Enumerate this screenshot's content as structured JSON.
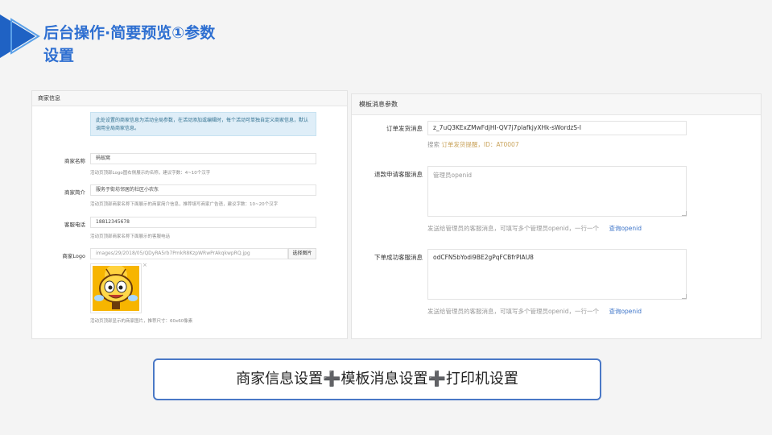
{
  "slide": {
    "title": "后台操作·简要预览①参数设置",
    "summary": "商家信息设置➕模板消息设置➕打印机设置"
  },
  "merchant_panel": {
    "heading": "商家信息",
    "notice": "此处设置的商家信息为活动全局参数，在活动添加或编辑时，每个活动可单独自定义商家信息，默认调用全局商家信息。",
    "name": {
      "label": "商家名称",
      "value": "蚂蚁窝",
      "help": "活动页顶部Logo图右侧展示的名称，建议字数：4~10个汉字"
    },
    "intro": {
      "label": "商家简介",
      "value": "服务于街坊邻居的社区小农东",
      "help": "活动页顶部商家名称下面展示的商家简介信息，推荐填写商家广告语，建议字数：10~20个汉字"
    },
    "phone": {
      "label": "客服电话",
      "value": "18812345678",
      "help": "活动页顶部商家名称下面展示的客服电话"
    },
    "logo": {
      "label": "商家Logo",
      "path": "images/29/2018/05/QDyRA5rb7PmkR8KzpWRwPrAkqkwpRQ.jpg",
      "button": "选择图片",
      "remove": "×",
      "help": "活动页顶部显示的商家图片，推荐尺寸：60x60像素"
    }
  },
  "template_panel": {
    "heading": "模板消息参数",
    "order_ship": {
      "label": "订单发货消息",
      "value": "z_7uQ3KExZMwFdjHI-QV7j7plafkjyXHk-sWordzS-I",
      "help_prefix": "搜索",
      "help_keyword": "订单发货提醒",
      "help_suffix": "，ID：AT0007"
    },
    "refund": {
      "label": "退款申请客服消息",
      "placeholder": "管理员openid",
      "help": "发送给管理员的客服消息，可填写多个管理员openid，一行一个",
      "link": "查询openid"
    },
    "order_success": {
      "label": "下单成功客服消息",
      "value": "odCFN5bYodi9BE2gPqFCBfrPlAU8",
      "help": "发送给管理员的客服消息，可填写多个管理员openid，一行一个",
      "link": "查询openid"
    }
  },
  "colors": {
    "accent": "#2e6fd1",
    "link": "#3f76c9",
    "notice_bg": "#dfeef8"
  }
}
